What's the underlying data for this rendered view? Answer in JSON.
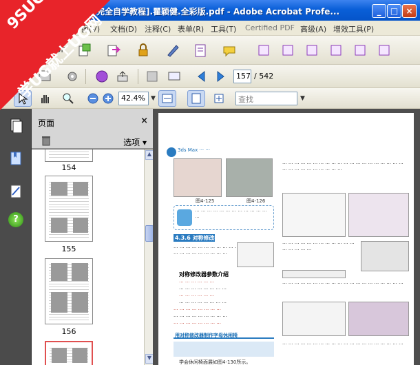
{
  "window": {
    "title": "完全自学教程].瞿颖健.全彩版.pdf - Adobe Acrobat Profe...",
    "minimize": "_",
    "maximize": "□",
    "close": "×"
  },
  "menu": {
    "items": [
      "图(V)",
      "文档(D)",
      "注释(C)",
      "表单(R)",
      "工具(T)",
      "Certified PDF",
      "高级(A)",
      "增效工具(P)"
    ]
  },
  "toolbar": {
    "page_current": "157",
    "page_total": "/ 542",
    "zoom": "42.4%",
    "search_placeholder": "查找",
    "pdf_label": "DF"
  },
  "nav_panel": {
    "title": "页面",
    "options": "选项",
    "close": "×",
    "thumbnails": [
      {
        "label": "154"
      },
      {
        "label": "155"
      },
      {
        "label": "156"
      }
    ]
  },
  "doc_page": {
    "section_title": "4.3.6 对称修改器",
    "sub_heading": "对称修改器参数介绍",
    "table_title": "用对称修改器制作字母休闲椅",
    "caption_1": "图4-125",
    "caption_2": "图4-126",
    "note": "学会休闲椅面展如图4-130所示。"
  },
  "logo": {
    "text_1": "9SUG",
    "text_2": "学UG就上UG网"
  },
  "colors": {
    "titlebar": "#0a5fd8",
    "logo_red": "#e8242a",
    "accent_blue": "#2a7bc0"
  }
}
